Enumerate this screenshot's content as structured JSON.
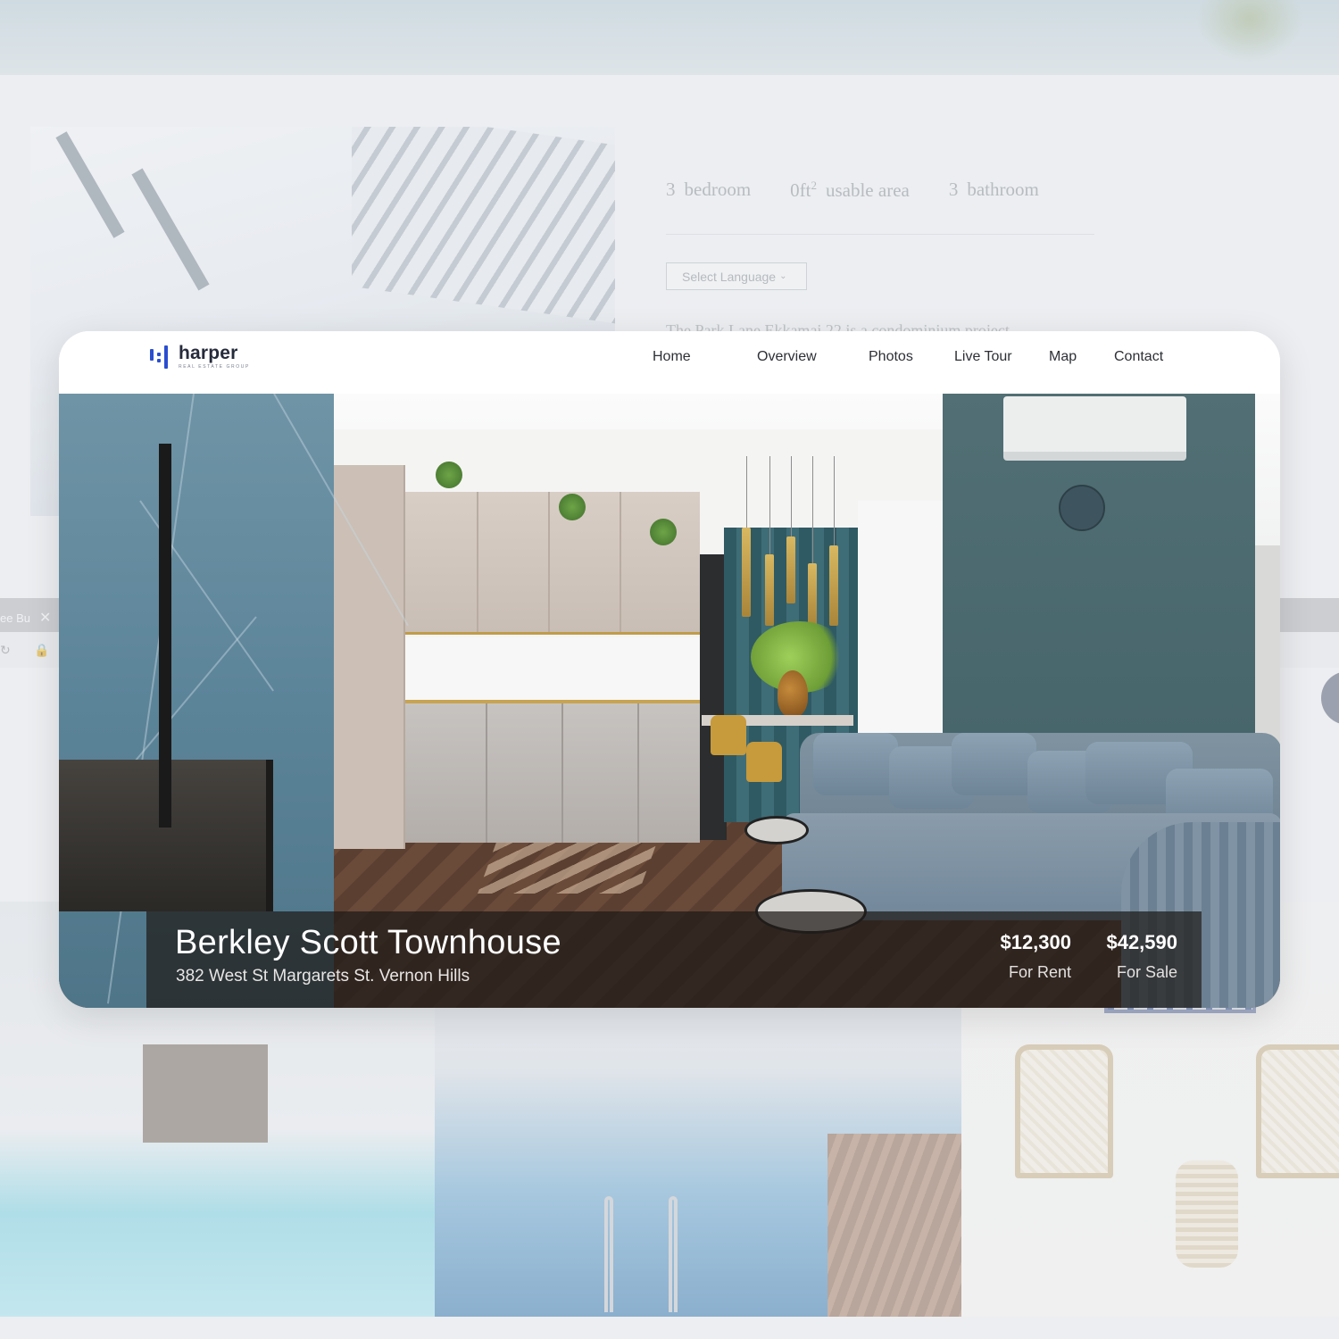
{
  "background": {
    "stats": [
      {
        "value": "3",
        "label": "bedroom"
      },
      {
        "value": "0ft",
        "sup": "2",
        "label": "usable area"
      },
      {
        "value": "3",
        "label": "bathroom"
      }
    ],
    "language_select": {
      "label": "Select Language",
      "icon": "chevron-down-icon"
    },
    "paragraph_fragment": "The Park Lane Ekkamai 22 is a condominium project",
    "browser_tab": {
      "label": "ee Bu",
      "close_icon": "close-icon"
    }
  },
  "brand": {
    "name": "harper",
    "tagline": "REAL ESTATE GROUP",
    "accent": "#2a4ed0"
  },
  "nav": {
    "items": [
      "Home",
      "Overview",
      "Photos",
      "Live Tour",
      "Map",
      "Contact"
    ]
  },
  "listing": {
    "title": "Berkley Scott Townhouse",
    "address": "382 West St Margarets St. Vernon Hills",
    "prices": [
      {
        "value": "$12,300",
        "label": "For Rent"
      },
      {
        "value": "$42,590",
        "label": "For Sale"
      }
    ]
  }
}
